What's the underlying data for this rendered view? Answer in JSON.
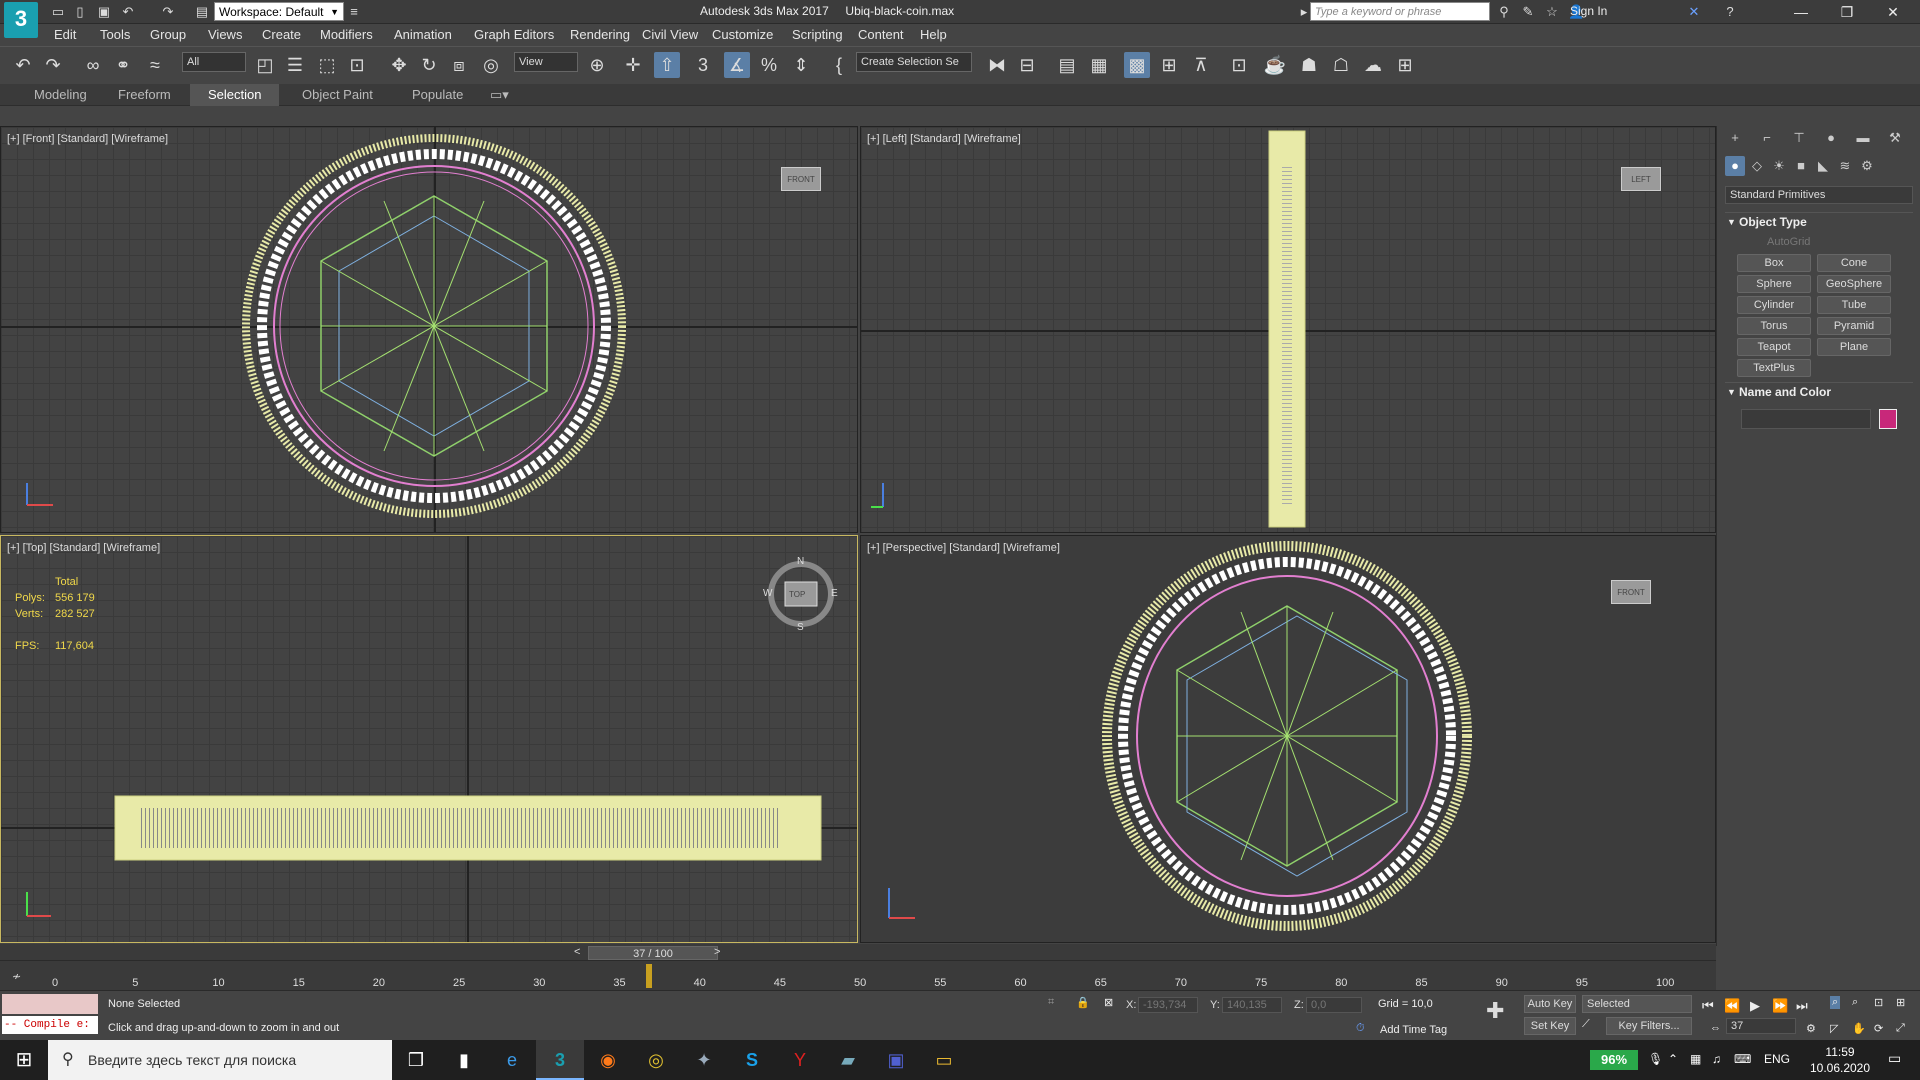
{
  "titlebar": {
    "app_title": "Autodesk 3ds Max 2017",
    "file_name": "Ubiq-black-coin.max",
    "workspace_label": "Workspace: Default",
    "search_placeholder": "Type a keyword or phrase",
    "sign_in": "Sign In",
    "logo": "3"
  },
  "menu": [
    "Edit",
    "Tools",
    "Group",
    "Views",
    "Create",
    "Modifiers",
    "Animation",
    "Graph Editors",
    "Rendering",
    "Civil View",
    "Customize",
    "Scripting",
    "Content",
    "Help"
  ],
  "toolbar": {
    "filter_dropdown": "All",
    "ref_coord_dropdown": "View",
    "selection_set_dropdown": "Create Selection Se"
  },
  "ribbon_tabs": [
    "Modeling",
    "Freeform",
    "Selection",
    "Object Paint",
    "Populate"
  ],
  "ribbon_active": "Selection",
  "viewports": {
    "front": {
      "label": "[+] [Front] [Standard] [Wireframe]",
      "cube": "FRONT"
    },
    "left": {
      "label": "[+] [Left] [Standard] [Wireframe]",
      "cube": "LEFT"
    },
    "top": {
      "label": "[+] [Top] [Standard] [Wireframe]",
      "cube": "TOP"
    },
    "perspective": {
      "label": "[+] [Perspective] [Standard] [Wireframe]",
      "cube": "FRONT"
    }
  },
  "stats": {
    "header": "Total",
    "polys_label": "Polys:",
    "polys_value": "556 179",
    "verts_label": "Verts:",
    "verts_value": "282 527",
    "fps_label": "FPS:",
    "fps_value": "117,604"
  },
  "compass": {
    "n": "N",
    "s": "S",
    "e": "E",
    "w": "W"
  },
  "command_panel": {
    "category_dropdown": "Standard Primitives",
    "object_type_title": "Object Type",
    "autogrid": "AutoGrid",
    "primitives": [
      "Box",
      "Cone",
      "Sphere",
      "GeoSphere",
      "Cylinder",
      "Tube",
      "Torus",
      "Pyramid",
      "Teapot",
      "Plane",
      "TextPlus"
    ],
    "name_color_title": "Name and Color",
    "object_color": "#c8287a"
  },
  "time_slider": {
    "position": "37 / 100",
    "current_frame": 37,
    "total_frames": 100,
    "ticks": [
      "0",
      "5",
      "10",
      "15",
      "20",
      "25",
      "30",
      "35",
      "40",
      "45",
      "50",
      "55",
      "60",
      "65",
      "70",
      "75",
      "80",
      "85",
      "90",
      "95",
      "100"
    ]
  },
  "status": {
    "maxscript_error": "-- Compile e:",
    "selection": "None Selected",
    "prompt": "Click and drag up-and-down to zoom in and out",
    "x_label": "X:",
    "x_value": "-193,734",
    "y_label": "Y:",
    "y_value": "140,135",
    "z_label": "Z:",
    "z_value": "0,0",
    "grid": "Grid = 10,0",
    "add_time_tag": "Add Time Tag",
    "auto_key": "Auto Key",
    "set_key": "Set Key",
    "selected_dropdown": "Selected",
    "key_filters": "Key Filters...",
    "frame_field": "37"
  },
  "taskbar": {
    "search_placeholder": "Введите здесь текст для поиска",
    "battery": "96%",
    "lang": "ENG",
    "time": "11:59",
    "date": "10.06.2020"
  }
}
